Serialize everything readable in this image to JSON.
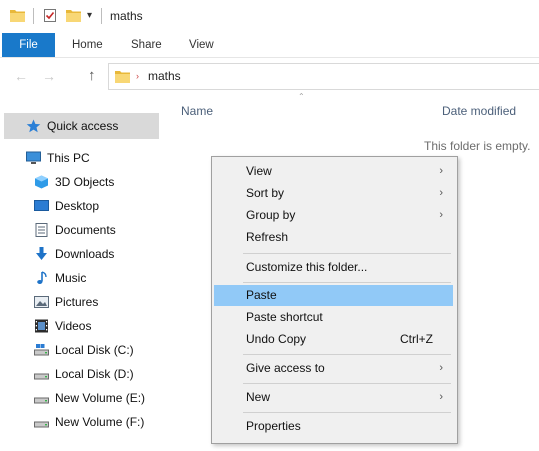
{
  "titlebar": {
    "title": "maths",
    "dropdown_glyph": "▾"
  },
  "ribbon": {
    "tabs": [
      "File",
      "Home",
      "Share",
      "View"
    ]
  },
  "address": {
    "back_glyph": "←",
    "forward_glyph": "→",
    "up_glyph": "↑",
    "separator_glyph": "›",
    "path": "maths"
  },
  "columns": {
    "name": "Name",
    "date_modified": "Date modified",
    "sort_glyph": "⌃"
  },
  "content": {
    "empty_message": "This folder is empty."
  },
  "sidebar": {
    "quick_access": "Quick access",
    "this_pc": "This PC",
    "items": [
      {
        "label": "3D Objects",
        "icon": "3d-objects-icon"
      },
      {
        "label": "Desktop",
        "icon": "desktop-icon"
      },
      {
        "label": "Documents",
        "icon": "documents-icon"
      },
      {
        "label": "Downloads",
        "icon": "downloads-icon"
      },
      {
        "label": "Music",
        "icon": "music-icon"
      },
      {
        "label": "Pictures",
        "icon": "pictures-icon"
      },
      {
        "label": "Videos",
        "icon": "videos-icon"
      },
      {
        "label": "Local Disk (C:)",
        "icon": "drive-c-icon"
      },
      {
        "label": "Local Disk (D:)",
        "icon": "drive-icon"
      },
      {
        "label": "New Volume (E:)",
        "icon": "drive-icon"
      },
      {
        "label": "New Volume (F:)",
        "icon": "drive-icon"
      }
    ]
  },
  "context_menu": {
    "view": "View",
    "sort_by": "Sort by",
    "group_by": "Group by",
    "refresh": "Refresh",
    "customize": "Customize this folder...",
    "paste": "Paste",
    "paste_shortcut": "Paste shortcut",
    "undo_copy": "Undo Copy",
    "undo_copy_shortcut": "Ctrl+Z",
    "give_access": "Give access to",
    "new": "New",
    "properties": "Properties",
    "submenu_glyph": "›",
    "highlighted_item": "Paste"
  },
  "colors": {
    "accent": "#1979ca",
    "menu_highlight": "#91c9f7",
    "folder_yellow": "#f8d775"
  }
}
